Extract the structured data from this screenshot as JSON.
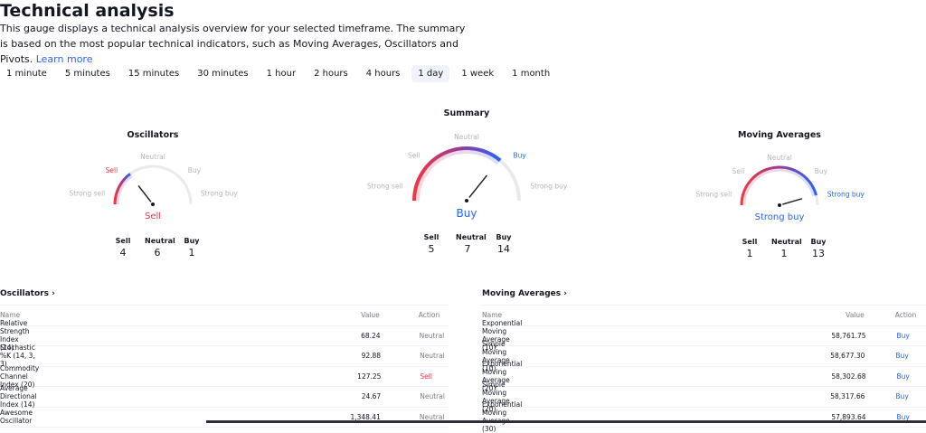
{
  "title": "Technical analysis",
  "description": "This gauge displays a technical analysis overview for your selected timeframe. The summary is based on the most popular technical indicators, such as Moving Averages, Oscillators and Pivots.",
  "learn_more": "Learn more",
  "tabs": [
    "1 minute",
    "5 minutes",
    "15 minutes",
    "30 minutes",
    "1 hour",
    "2 hours",
    "4 hours",
    "1 day",
    "1 week",
    "1 month"
  ],
  "active_tab": "1 day",
  "colors": {
    "sell": "#f23645",
    "buy": "#2962ff",
    "neutral": "#787b86",
    "arc_gradient": [
      "#f23645",
      "#9c3b8f",
      "#2962ff"
    ]
  },
  "gauge_labels": {
    "strong_sell": "Strong sell",
    "sell": "Sell",
    "neutral": "Neutral",
    "buy": "Buy",
    "strong_buy": "Strong buy"
  },
  "gauges": [
    {
      "id": "osc",
      "title": "Oscillators",
      "result": "Sell",
      "result_level": "sell",
      "needle_value": -0.42,
      "counts": {
        "sell_label": "Sell",
        "neutral_label": "Neutral",
        "buy_label": "Buy",
        "sell": "4",
        "neutral": "6",
        "buy": "1"
      }
    },
    {
      "id": "sum",
      "title": "Summary",
      "result": "Buy",
      "result_level": "buy",
      "needle_value": 0.43,
      "counts": {
        "sell_label": "Sell",
        "neutral_label": "Neutral",
        "buy_label": "Buy",
        "sell": "5",
        "neutral": "7",
        "buy": "14"
      }
    },
    {
      "id": "ma",
      "title": "Moving Averages",
      "result": "Strong buy",
      "result_level": "strong_buy",
      "needle_value": 0.82,
      "counts": {
        "sell_label": "Sell",
        "neutral_label": "Neutral",
        "buy_label": "Buy",
        "sell": "1",
        "neutral": "1",
        "buy": "13"
      }
    }
  ],
  "oscillators_table": {
    "title": "Oscillators ›",
    "headers": [
      "Name",
      "Value",
      "Action"
    ],
    "rows": [
      {
        "name": "Relative Strength Index (14)",
        "value": "68.24",
        "action": "Neutral"
      },
      {
        "name": "Stochastic %K (14, 3, 3)",
        "value": "92.88",
        "action": "Neutral"
      },
      {
        "name": "Commodity Channel Index (20)",
        "value": "127.25",
        "action": "Sell"
      },
      {
        "name": "Average Directional Index (14)",
        "value": "24.67",
        "action": "Neutral"
      },
      {
        "name": "Awesome Oscillator",
        "value": "1,348.41",
        "action": "Neutral"
      }
    ]
  },
  "ma_table": {
    "title": "Moving Averages ›",
    "headers": [
      "Name",
      "Value",
      "Action"
    ],
    "rows": [
      {
        "name": "Exponential Moving Average (10)",
        "value": "58,761.75",
        "action": "Buy"
      },
      {
        "name": "Simple Moving Average (10)",
        "value": "58,677.30",
        "action": "Buy"
      },
      {
        "name": "Exponential Moving Average (20)",
        "value": "58,302.68",
        "action": "Buy"
      },
      {
        "name": "Simple Moving Average (20)",
        "value": "58,317.66",
        "action": "Buy"
      },
      {
        "name": "Exponential Moving Average (30)",
        "value": "57,893.64",
        "action": "Buy"
      }
    ]
  }
}
